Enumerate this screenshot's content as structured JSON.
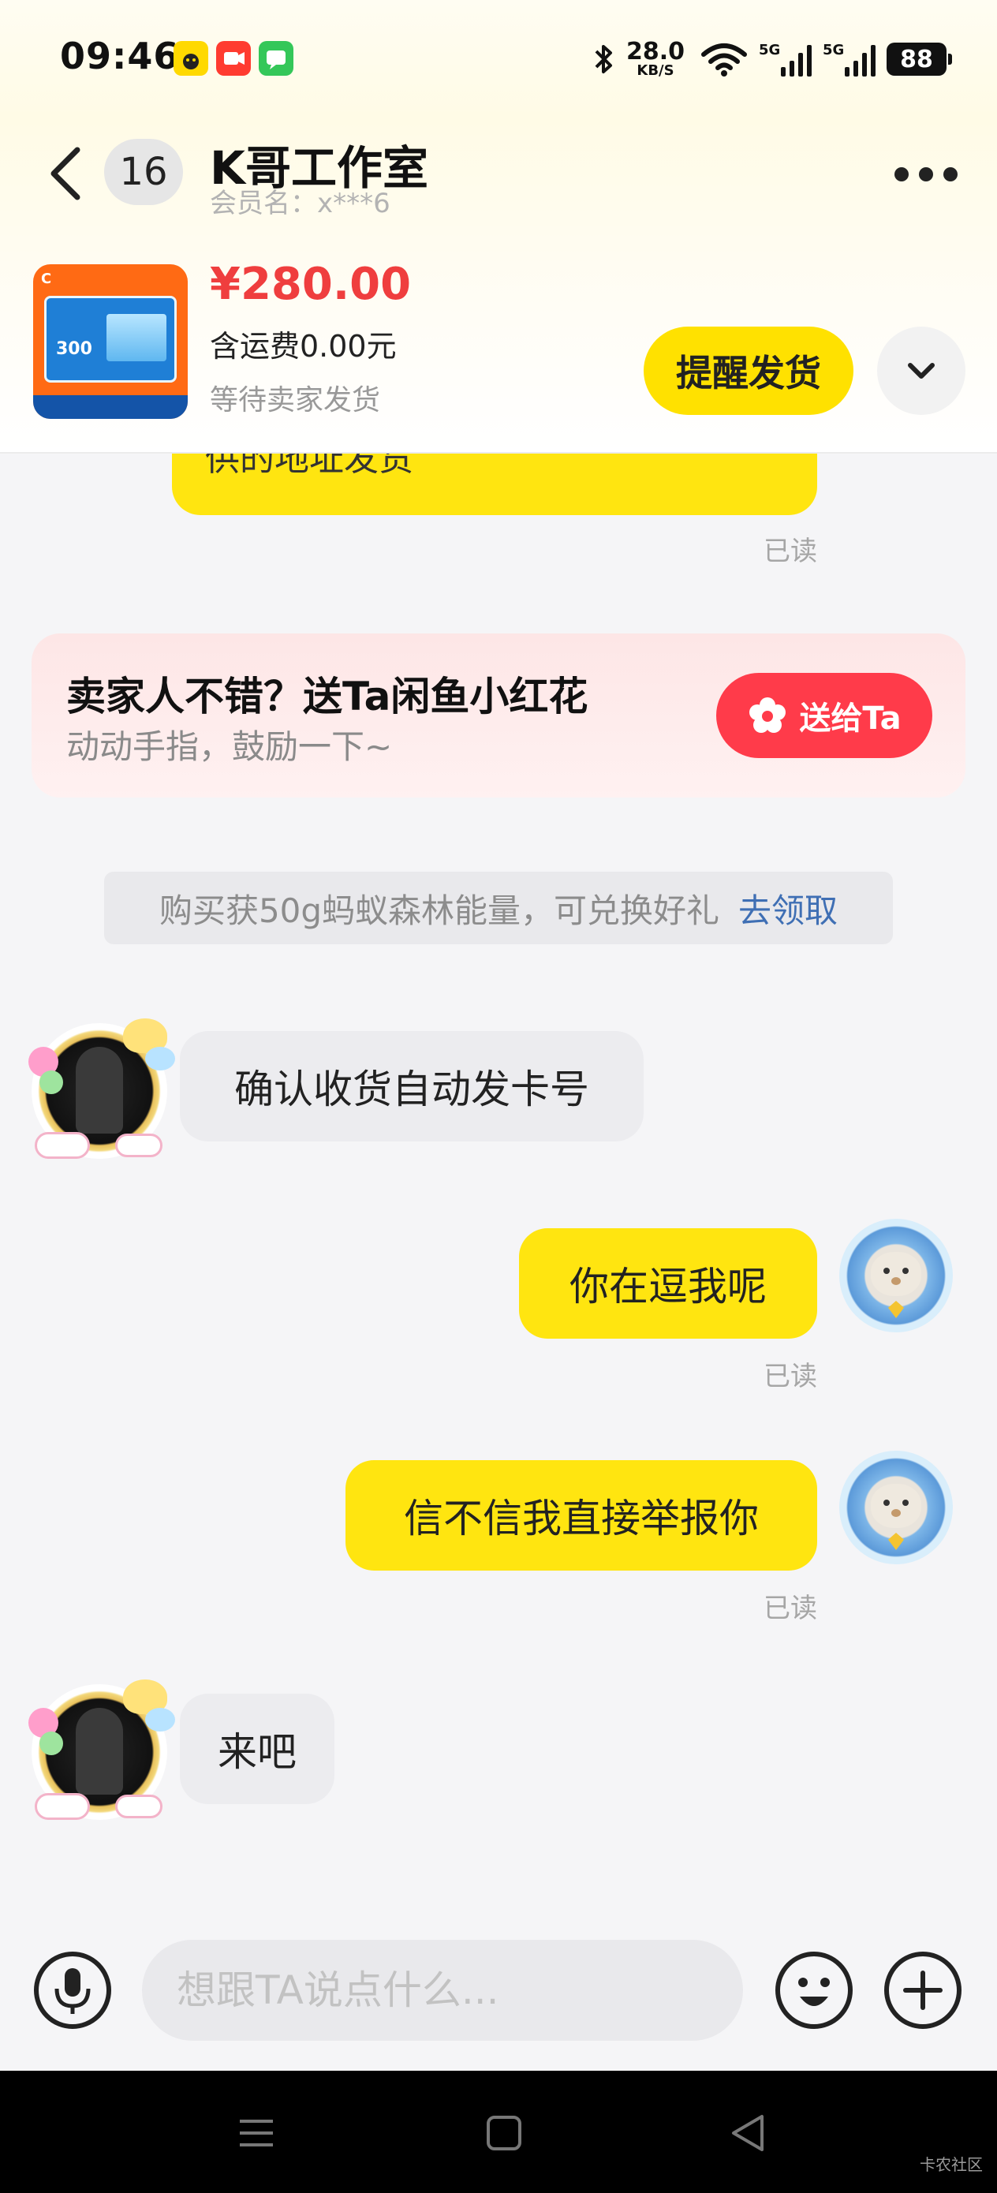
{
  "status_bar": {
    "time": "09:46",
    "net_speed_value": "28.0",
    "net_speed_unit": "KB/S",
    "signal1_label": "5G",
    "signal2_label": "5G",
    "battery": "88",
    "icons": [
      "app-icon-yellow",
      "video-icon",
      "chat-icon",
      "bluetooth-icon",
      "wifi-icon",
      "signal-icon",
      "signal-icon",
      "battery-icon"
    ]
  },
  "header": {
    "unread_count": "16",
    "shop_name": "K哥工作室",
    "member": "会员名：x***6"
  },
  "order": {
    "price": "¥280.00",
    "shipping": "含运费0.00元",
    "status": "等待卖家发货",
    "remind_label": "提醒发货",
    "thumb_value": "300"
  },
  "messages": {
    "partial_text": "供的地址发货",
    "read_label": "已读",
    "flower_card": {
      "title": "卖家人不错？送Ta闲鱼小红花",
      "subtitle": "动动手指，鼓励一下~",
      "button": "送给Ta"
    },
    "energy_tip": {
      "text": "购买获50g蚂蚁森林能量，可兑换好礼",
      "link": "去领取"
    },
    "seller_msg1": "确认收货自动发卡号",
    "my_msg1": "你在逗我呢",
    "my_msg2": "信不信我直接举报你",
    "seller_msg2": "来吧"
  },
  "input": {
    "placeholder": "想跟TA说点什么..."
  },
  "watermark": "卡农社区",
  "colors": {
    "accent_yellow": "#ffe510",
    "price_red": "#ef3e3e",
    "flower_red": "#ff3b4a",
    "link_blue": "#3f6fb4"
  }
}
